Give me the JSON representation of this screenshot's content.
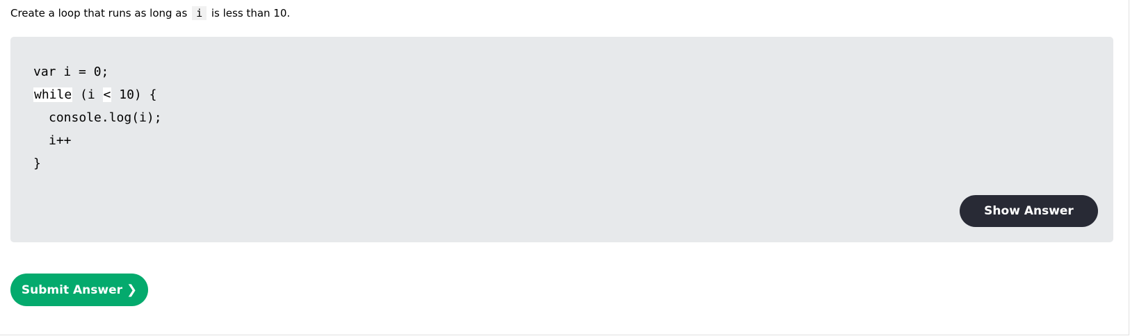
{
  "instruction": {
    "before": "Create a loop that runs as long as",
    "variable": "i",
    "after": "is less than 10."
  },
  "code": {
    "line1": "var i = 0;",
    "line2_blank1": "while",
    "line2_mid": " (i ",
    "line2_blank2": "<",
    "line2_end": " 10) {",
    "line3": "console.log(i);",
    "line4": "i++",
    "line5": "}"
  },
  "buttons": {
    "show_answer": "Show Answer",
    "submit_answer": "Submit Answer",
    "submit_icon": "❯"
  },
  "colors": {
    "code_panel_bg": "#e7e9eb",
    "show_answer_bg": "#282a35",
    "submit_bg": "#04aa6d",
    "field_bg": "#ffffff"
  }
}
